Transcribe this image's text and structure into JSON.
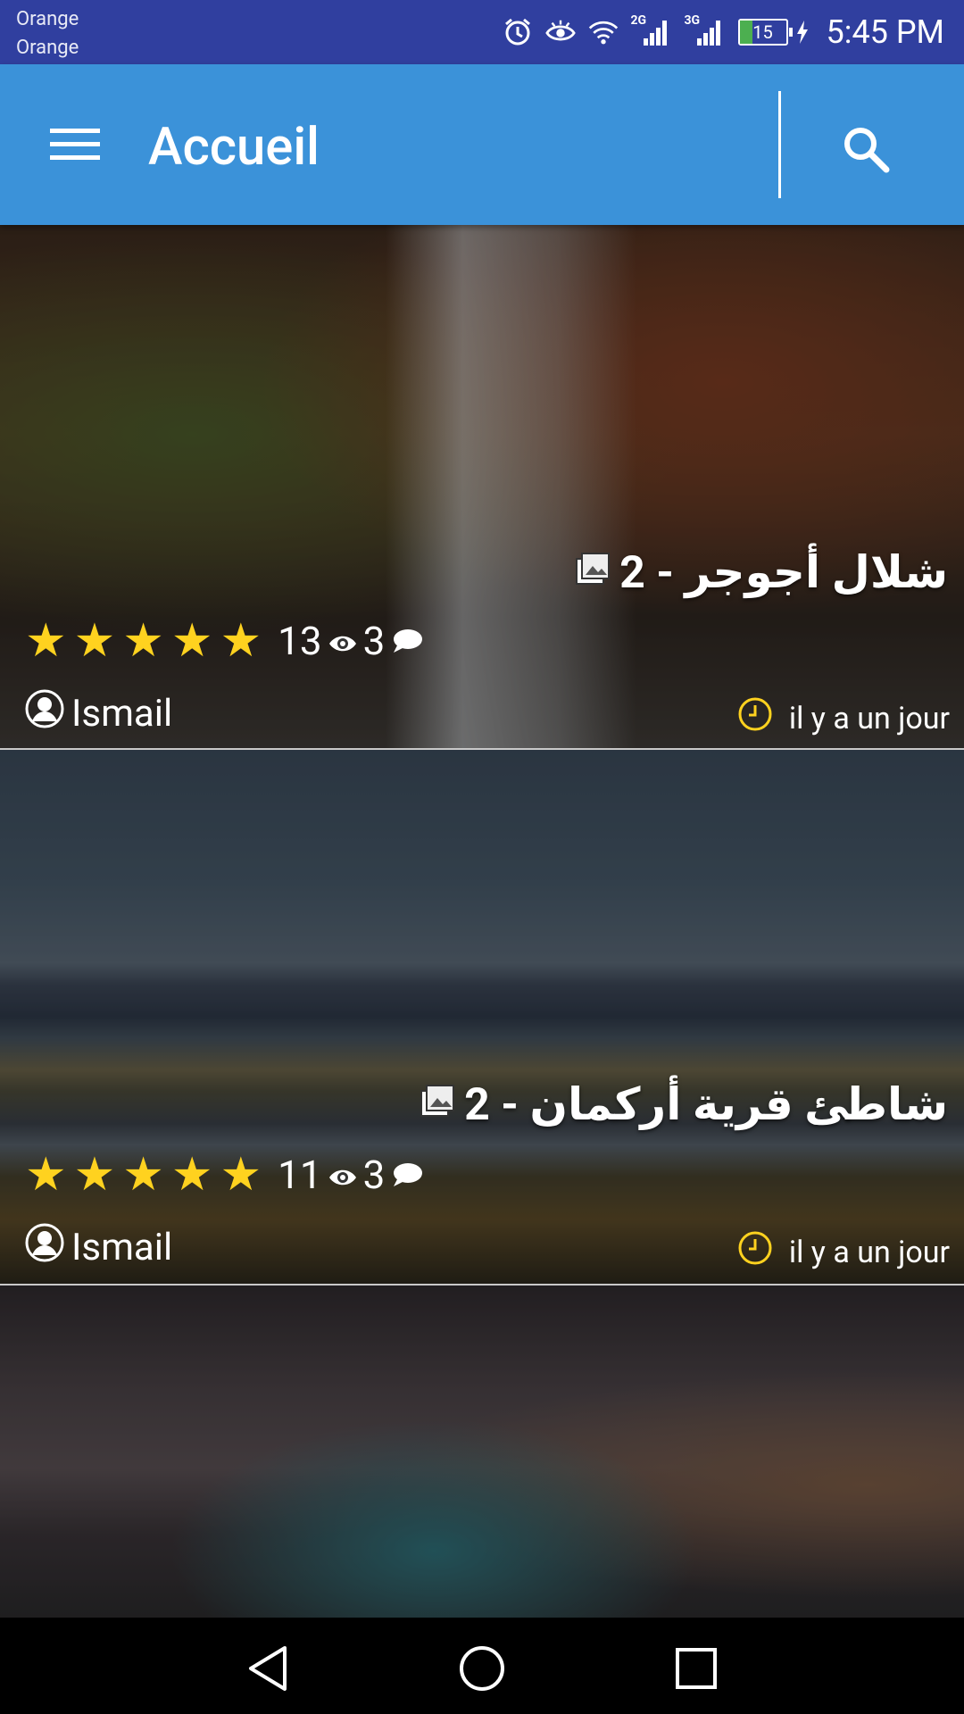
{
  "status_bar": {
    "carrier_1": "Orange",
    "carrier_2": "Orange",
    "network_2g": "2G",
    "network_3g": "3G",
    "battery": "15",
    "time": "5:45 PM"
  },
  "app_bar": {
    "title": "Accueil",
    "menu_icon": "hamburger-menu-icon",
    "search_icon": "search-icon"
  },
  "posts": [
    {
      "title": "شلال أجوجر - 2",
      "rating": 5,
      "views": "13",
      "comments": "3",
      "author": "Ismail",
      "time": "il y a un jour"
    },
    {
      "title": "شاطئ قرية أركمان - 2",
      "rating": 5,
      "views": "11",
      "comments": "3",
      "author": "Ismail",
      "time": "il y a un jour"
    },
    {
      "title": "",
      "rating": 0,
      "views": "",
      "comments": "",
      "author": "",
      "time": ""
    }
  ],
  "colors": {
    "status_bar": "#303f9f",
    "app_bar": "#3b92d9",
    "star": "#ffd21f",
    "clock": "#ffd21f"
  }
}
